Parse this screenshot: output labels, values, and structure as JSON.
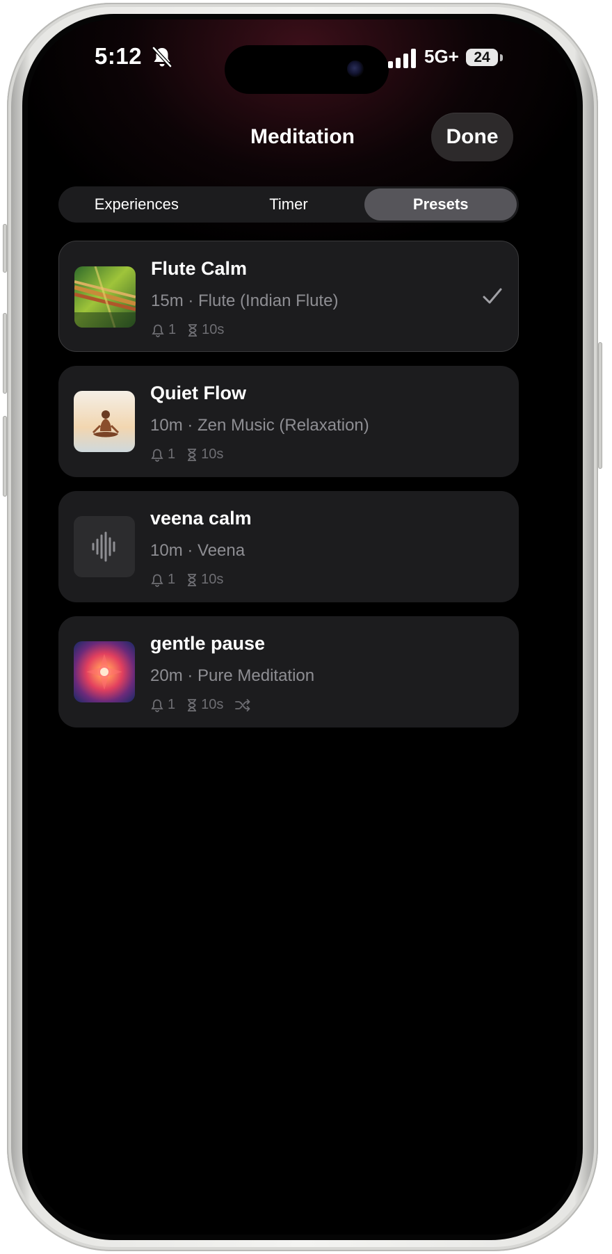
{
  "status_bar": {
    "time": "5:12",
    "network": "5G+",
    "battery": "24"
  },
  "header": {
    "title": "Meditation",
    "done_label": "Done"
  },
  "tabs": [
    {
      "label": "Experiences",
      "active": false
    },
    {
      "label": "Timer",
      "active": false
    },
    {
      "label": "Presets",
      "active": true
    }
  ],
  "presets": [
    {
      "name": "Flute Calm",
      "subtitle": "15m · Flute (Indian Flute)",
      "bells": "1",
      "interval": "10s",
      "selected": true,
      "artwork": "flute-album-art"
    },
    {
      "name": "Quiet Flow",
      "subtitle": "10m · Zen Music (Relaxation)",
      "bells": "1",
      "interval": "10s",
      "selected": false,
      "artwork": "meditation-album-art"
    },
    {
      "name": "veena calm",
      "subtitle": "10m · Veena",
      "bells": "1",
      "interval": "10s",
      "selected": false,
      "artwork": "waveform-icon"
    },
    {
      "name": "gentle pause",
      "subtitle": "20m · Pure Meditation",
      "bells": "1",
      "interval": "10s",
      "shuffle": true,
      "selected": false,
      "artwork": "pure-meditation-album-art"
    }
  ],
  "colors": {
    "card_bg": "#1c1c1e",
    "active_segment": "#56555a",
    "secondary_text": "#8e8e93"
  }
}
